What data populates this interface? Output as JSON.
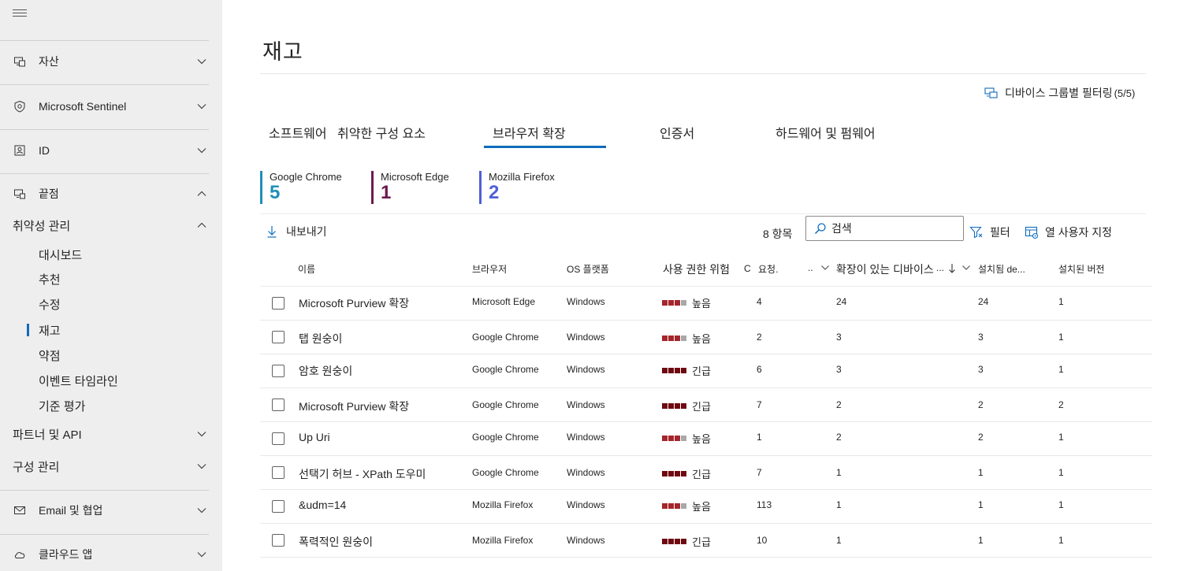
{
  "sidebar": {
    "items": [
      {
        "label": "자산",
        "icon": "devices-icon"
      },
      {
        "label": "Microsoft Sentinel",
        "icon": "sentinel-shield-icon"
      },
      {
        "label": "ID",
        "icon": "identity-icon"
      },
      {
        "label": "끝점",
        "icon": "endpoints-icon"
      }
    ],
    "vuln_mgmt": "취약성 관리",
    "sub_items": [
      "대시보드",
      "추천",
      "수정",
      "재고",
      "약점",
      "이벤트 타임라인",
      "기준 평가"
    ],
    "partners": "파트너 및 API",
    "config": "구성 관리",
    "email": "Email 및 협업",
    "cloud_apps": "클라우드 앱"
  },
  "page": {
    "title": "재고",
    "group_filter_label": "디바이스 그룹별 필터링",
    "group_filter_count": "(5/5)"
  },
  "tabs": [
    "소프트웨어",
    "취약한 구성 요소",
    "브라우저 확장",
    "인증서",
    "하드웨어 및 펌웨어"
  ],
  "stats": [
    {
      "name": "Google Chrome",
      "value": "5",
      "color": "#1f8fb8"
    },
    {
      "name": "Microsoft Edge",
      "value": "1",
      "color": "#6b1a4f"
    },
    {
      "name": "Mozilla Firefox",
      "value": "2",
      "color": "#4f5fd6"
    }
  ],
  "toolbar": {
    "export_label": "내보내기",
    "items_count": "8 항목",
    "search_placeholder": "검색",
    "filter_label": "필터",
    "customize_label": "열 사용자 지정"
  },
  "table": {
    "headers": [
      "이름",
      "브라우저",
      "OS 플랫폼",
      "사용 권한 위험",
      "C",
      "요청.",
      "..",
      "확장이 있는 디바이스",
      "...",
      "설치됨 de...",
      "설치된 버전"
    ],
    "rows": [
      {
        "name": "Microsoft Purview 확장",
        "browser": "Microsoft Edge",
        "os": "Windows",
        "risk": "높음",
        "level": 3,
        "requests": "4",
        "devices": "24",
        "installed": "24",
        "versions": "1"
      },
      {
        "name": "탭 원숭이",
        "browser": "Google Chrome",
        "os": "Windows",
        "risk": "높음",
        "level": 3,
        "requests": "2",
        "devices": "3",
        "installed": "3",
        "versions": "1"
      },
      {
        "name": "암호 원숭이",
        "browser": "Google Chrome",
        "os": "Windows",
        "risk": "긴급",
        "level": 4,
        "requests": "6",
        "devices": "3",
        "installed": "3",
        "versions": "1"
      },
      {
        "name": "Microsoft Purview 확장",
        "browser": "Google Chrome",
        "os": "Windows",
        "risk": "긴급",
        "level": 4,
        "requests": "7",
        "devices": "2",
        "installed": "2",
        "versions": "2"
      },
      {
        "name": "Up Uri",
        "browser": "Google Chrome",
        "os": "Windows",
        "risk": "높음",
        "level": 3,
        "requests": "1",
        "devices": "2",
        "installed": "2",
        "versions": "1"
      },
      {
        "name": "선택기 허브 - XPath 도우미",
        "browser": "Google Chrome",
        "os": "Windows",
        "risk": "긴급",
        "level": 4,
        "requests": "7",
        "devices": "1",
        "installed": "1",
        "versions": "1"
      },
      {
        "name": "&udm=14",
        "browser": "Mozilla Firefox",
        "os": "Windows",
        "risk": "높음",
        "level": 3,
        "requests": "113",
        "devices": "1",
        "installed": "1",
        "versions": "1"
      },
      {
        "name": "폭력적인 원숭이",
        "browser": "Mozilla Firefox",
        "os": "Windows",
        "risk": "긴급",
        "level": 4,
        "requests": "10",
        "devices": "1",
        "installed": "1",
        "versions": "1"
      }
    ]
  },
  "colors": {
    "accent": "#0f6cbd",
    "high_fill": "#a4262c",
    "critical_fill": "#6e0811",
    "empty_fill": "#a8a8a8"
  }
}
